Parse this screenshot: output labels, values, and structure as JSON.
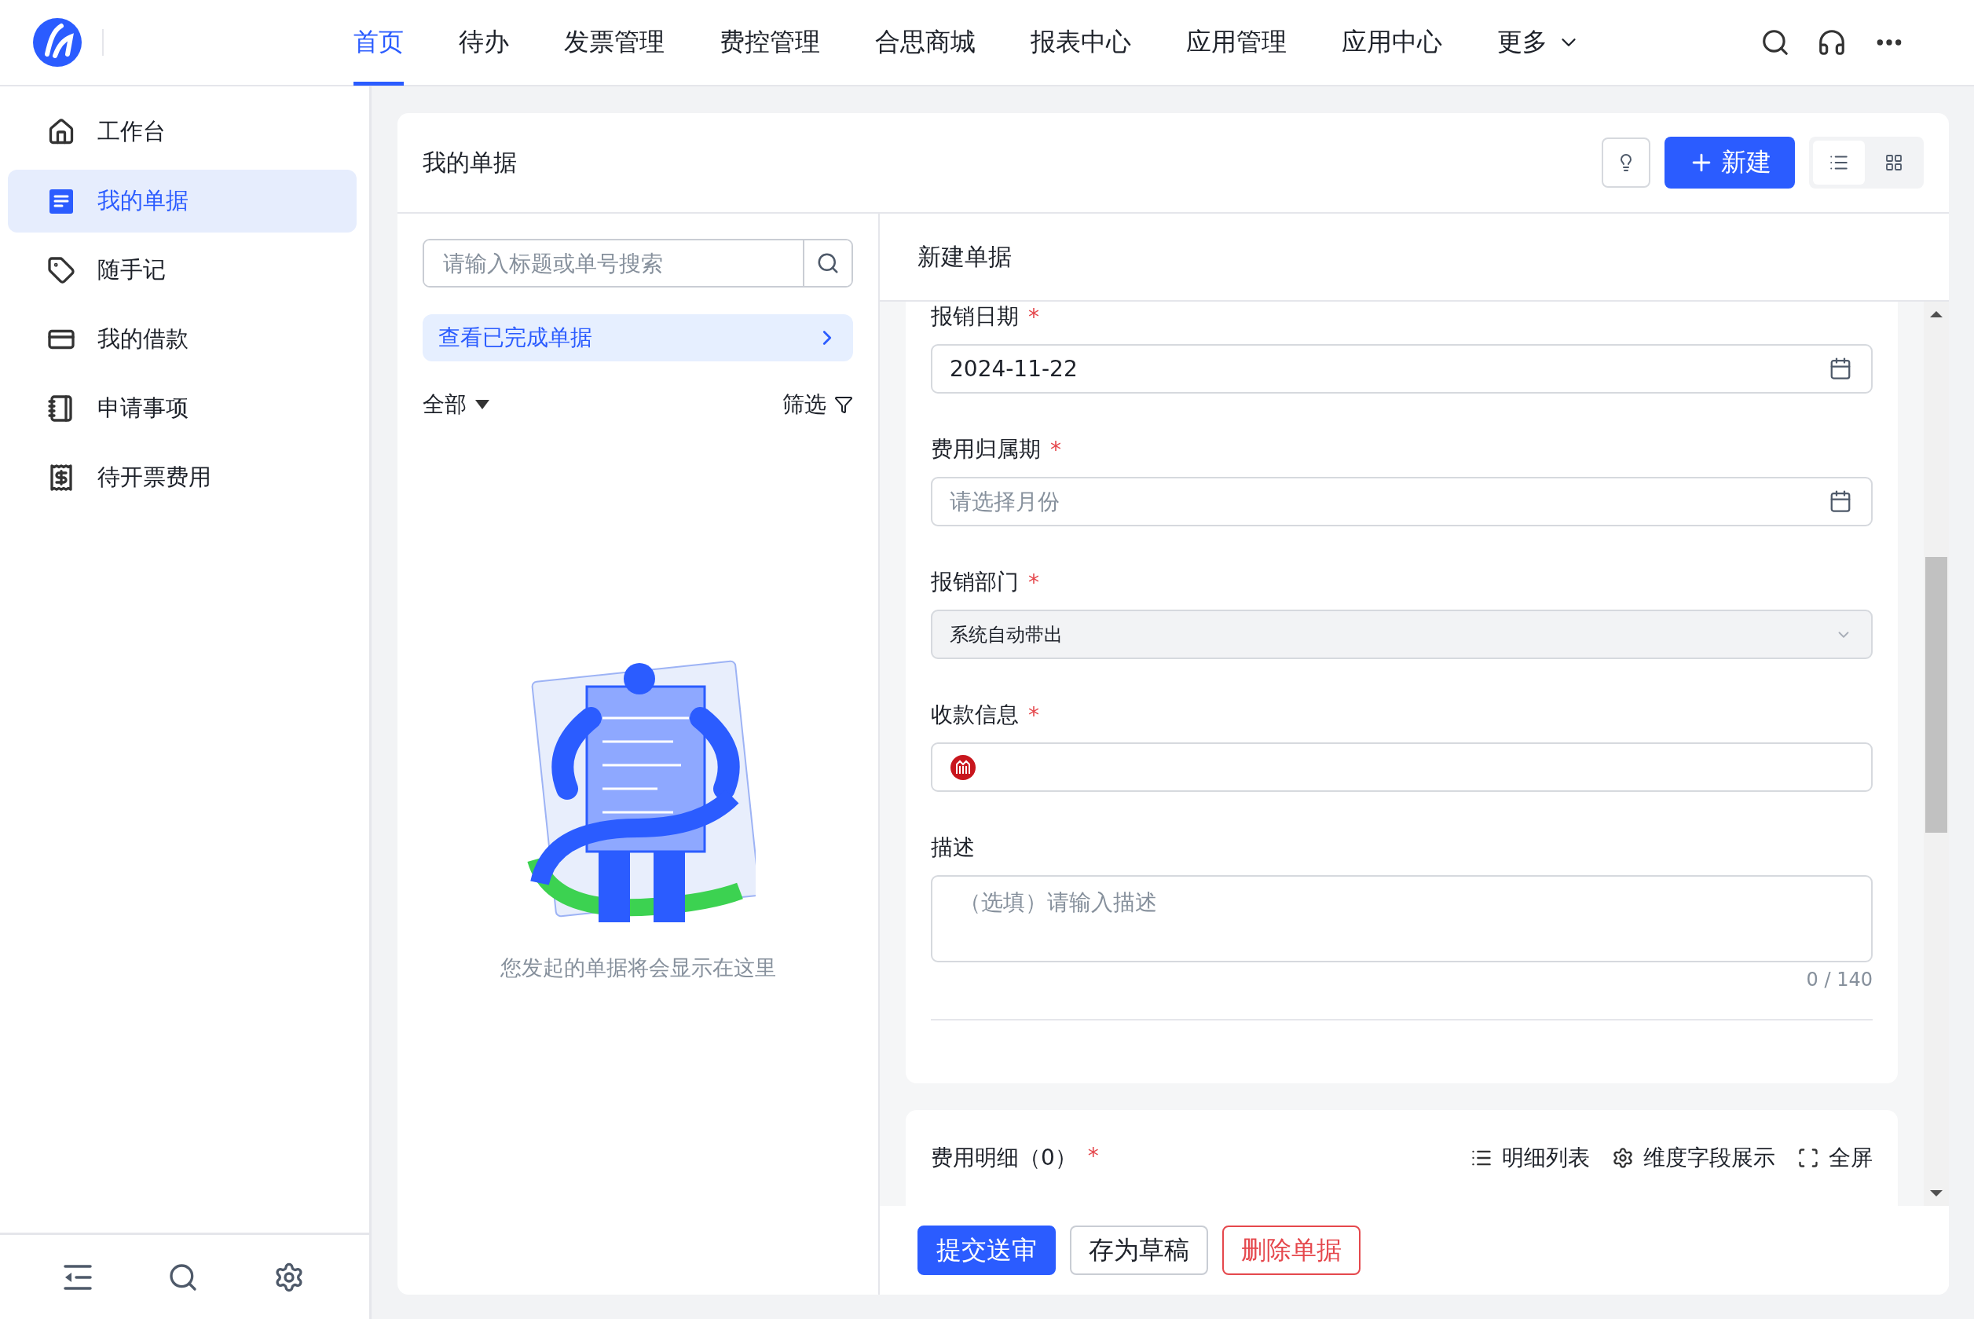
{
  "nav": {
    "items": [
      {
        "label": "首页",
        "selected": true
      },
      {
        "label": "待办",
        "selected": false
      },
      {
        "label": "发票管理",
        "selected": false
      },
      {
        "label": "费控管理",
        "selected": false
      },
      {
        "label": "合思商城",
        "selected": false
      },
      {
        "label": "报表中心",
        "selected": false
      },
      {
        "label": "应用管理",
        "selected": false
      },
      {
        "label": "应用中心",
        "selected": false
      }
    ],
    "more": "更多"
  },
  "sidebar": {
    "items": [
      {
        "kind": "home",
        "label": "工作台",
        "selected": false
      },
      {
        "kind": "document",
        "label": "我的单据",
        "selected": true
      },
      {
        "kind": "note",
        "label": "随手记",
        "selected": false
      },
      {
        "kind": "wallet",
        "label": "我的借款",
        "selected": false
      },
      {
        "kind": "book",
        "label": "申请事项",
        "selected": false
      },
      {
        "kind": "receipt",
        "label": "待开票费用",
        "selected": false
      }
    ]
  },
  "panel": {
    "title": "我的单据",
    "new_button": "新建",
    "view_modes": [
      {
        "kind": "list",
        "selected": true
      },
      {
        "kind": "grid",
        "selected": false
      }
    ]
  },
  "list": {
    "search": {
      "placeholder": "请输入标题或单号搜索"
    },
    "completed_link": "查看已完成单据",
    "scope": "全部",
    "filter": "筛选",
    "empty_text": "您发起的单据将会显示在这里"
  },
  "form": {
    "title": "新建单据",
    "required_mark": "*",
    "fields": [
      {
        "kind": "date",
        "label": "报销日期",
        "required": true,
        "value": "2024-11-22"
      },
      {
        "kind": "date",
        "label": "费用归属期",
        "required": true,
        "placeholder": "请选择月份"
      },
      {
        "kind": "select",
        "label": "报销部门",
        "required": true,
        "value": "系统自动带出"
      },
      {
        "kind": "payee",
        "label": "收款信息",
        "required": true
      },
      {
        "kind": "textarea",
        "label": "描述",
        "required": false,
        "placeholder": "（选填）请输入描述",
        "counter": "0 / 140"
      }
    ]
  },
  "details": {
    "title": "费用明细（0）",
    "required": true,
    "required_mark": "*",
    "actions": [
      {
        "kind": "list",
        "label": "明细列表"
      },
      {
        "kind": "gear",
        "label": "维度字段展示"
      },
      {
        "kind": "expand",
        "label": "全屏"
      }
    ]
  },
  "footer": {
    "buttons": [
      {
        "kind": "primary",
        "label": "提交送审"
      },
      {
        "kind": "default",
        "label": "存为草稿"
      },
      {
        "kind": "danger",
        "label": "删除单据"
      }
    ]
  }
}
